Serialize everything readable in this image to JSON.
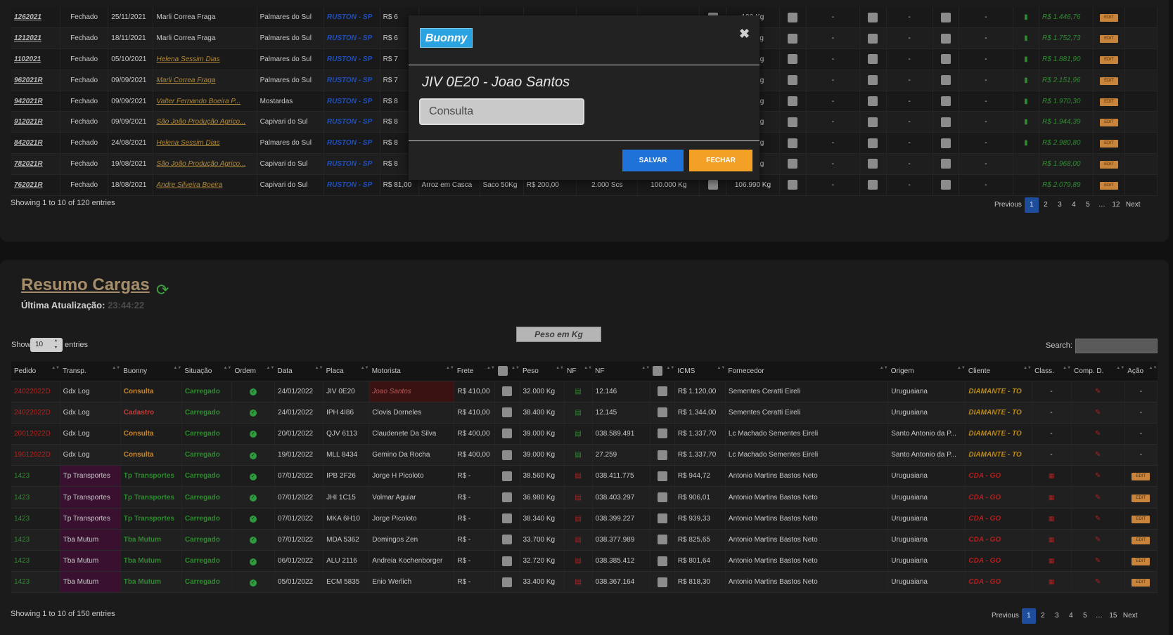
{
  "top_table": {
    "rows": [
      {
        "pedido": "1262021",
        "status": "Fechado",
        "data": "25/11/2021",
        "cliente": "Marli Correa Fraga",
        "cliente_link": false,
        "cidade": "Palmares do Sul",
        "transp": "RUSTON - SP",
        "valor": "R$ 6",
        "tipo": "",
        "emb": "",
        "total": "",
        "qtd": "",
        "peso": "",
        "peso_real": "190 Kg",
        "doc": true,
        "total_final": "R$ 1.446,76",
        "acao": "EDIT"
      },
      {
        "pedido": "1212021",
        "status": "Fechado",
        "data": "18/11/2021",
        "cliente": "Marli Correa Fraga",
        "cliente_link": false,
        "cidade": "Palmares do Sul",
        "transp": "RUSTON - SP",
        "valor": "R$ 6",
        "tipo": "",
        "emb": "",
        "total": "",
        "qtd": "",
        "peso": "",
        "peso_real": "110 Kg",
        "doc": true,
        "total_final": "R$ 1.752,73",
        "acao": "EDIT"
      },
      {
        "pedido": "1102021",
        "status": "Fechado",
        "data": "05/10/2021",
        "cliente": "Helena Sessim Dias",
        "cliente_link": true,
        "cidade": "Palmares do Sul",
        "transp": "RUSTON - SP",
        "valor": "R$ 7",
        "tipo": "",
        "emb": "",
        "total": "",
        "qtd": "",
        "peso": "",
        "peso_real": "550 Kg",
        "doc": true,
        "total_final": "R$ 1.881,90",
        "acao": "EDIT"
      },
      {
        "pedido": "962021R",
        "status": "Fechado",
        "data": "09/09/2021",
        "cliente": "Marli Correa Fraga",
        "cliente_link": true,
        "cidade": "Palmares do Sul",
        "transp": "RUSTON - SP",
        "valor": "R$ 7",
        "tipo": "",
        "emb": "",
        "total": "",
        "qtd": "",
        "peso": "",
        "peso_real": "500 Kg",
        "doc": true,
        "total_final": "R$ 2.151,96",
        "acao": "EDIT"
      },
      {
        "pedido": "942021R",
        "status": "Fechado",
        "data": "09/09/2021",
        "cliente": "Valter Fernando Boeira P...",
        "cliente_link": true,
        "cidade": "Mostardas",
        "transp": "RUSTON - SP",
        "valor": "R$ 8",
        "tipo": "",
        "emb": "",
        "total": "",
        "qtd": "",
        "peso": "",
        "peso_real": "620 Kg",
        "doc": true,
        "total_final": "R$ 1.970,30",
        "acao": "EDIT"
      },
      {
        "pedido": "912021R",
        "status": "Fechado",
        "data": "09/09/2021",
        "cliente": "São João Produção Agrico...",
        "cliente_link": true,
        "cidade": "Capivari do Sul",
        "transp": "RUSTON - SP",
        "valor": "R$ 8",
        "tipo": "",
        "emb": "",
        "total": "",
        "qtd": "",
        "peso": "",
        "peso_real": "020 Kg",
        "doc": true,
        "total_final": "R$ 1.944,39",
        "acao": "EDIT"
      },
      {
        "pedido": "842021R",
        "status": "Fechado",
        "data": "24/08/2021",
        "cliente": "Helena Sessim Dias",
        "cliente_link": true,
        "cidade": "Palmares do Sul",
        "transp": "RUSTON - SP",
        "valor": "R$ 8",
        "tipo": "",
        "emb": "",
        "total": "",
        "qtd": "",
        "peso": "",
        "peso_real": "250 Kg",
        "doc": true,
        "total_final": "R$ 2.980,80",
        "acao": "EDIT"
      },
      {
        "pedido": "782021R",
        "status": "Fechado",
        "data": "19/08/2021",
        "cliente": "São João Produção Agrico...",
        "cliente_link": true,
        "cidade": "Capivari do Sul",
        "transp": "RUSTON - SP",
        "valor": "R$ 8",
        "tipo": "",
        "emb": "",
        "total": "",
        "qtd": "",
        "peso": "",
        "peso_real": "000 Kg",
        "doc": false,
        "total_final": "R$ 1.968,00",
        "acao": "EDIT"
      },
      {
        "pedido": "762021R",
        "status": "Fechado",
        "data": "18/08/2021",
        "cliente": "Andre Silveira Boeira",
        "cliente_link": true,
        "cidade": "Capivari do Sul",
        "transp": "RUSTON - SP",
        "valor": "R$ 81,00",
        "tipo": "Arroz em Casca",
        "emb": "Saco 50Kg",
        "total": "R$ 200,00",
        "qtd": "2.000 Scs",
        "peso": "100.000 Kg",
        "peso_real": "106.990 Kg",
        "doc": false,
        "total_final": "R$ 2.079,89",
        "acao": "EDIT"
      }
    ],
    "dash": "-",
    "info": "Showing 1 to 10 of 120 entries",
    "pager": {
      "previous": "Previous",
      "pages": [
        "1",
        "2",
        "3",
        "4",
        "5",
        "…",
        "12"
      ],
      "next": "Next"
    }
  },
  "modal": {
    "logo": "Buonny",
    "close_icon": "close-icon",
    "title": "JIV 0E20 - Joao Santos",
    "input_value": "Consulta",
    "save_label": "SALVAR",
    "close_label": "FECHAR",
    "colors": {
      "save": "#1f72d8",
      "close": "#f3a126",
      "logo": "#2aa3e0"
    }
  },
  "resumo": {
    "title": "Resumo Cargas",
    "refresh_icon": "refresh-icon",
    "updated_label": "Última Atualização:",
    "updated_time": "23:44:22",
    "unit_label": "Peso em Kg",
    "show_label": "Show",
    "show_value": "10",
    "entries_label": "entries",
    "search_label": "Search:",
    "search_value": "",
    "columns": [
      "Pedido",
      "Transp.",
      "Buonny",
      "Situação",
      "Ordem",
      "Data",
      "Placa",
      "Motorista",
      "Frete",
      "",
      "Peso",
      "NF",
      "NF",
      "",
      "ICMS",
      "Fornecedor",
      "Origem",
      "Cliente",
      "Class.",
      "Comp. D.",
      "Ação"
    ],
    "rows": [
      {
        "pedido": "24022022D",
        "transp": "Gdx Log",
        "buonny": "Consulta",
        "situacao": "Carregado",
        "data": "24/01/2022",
        "placa": "JIV 0E20",
        "motorista": "Joao Santos",
        "frete": "R$ 410,00",
        "peso": "32.000 Kg",
        "nf": "12.146",
        "icms": "R$ 1.120,00",
        "fornecedor": "Sementes Ceratti Eireli",
        "origem": "Uruguaiana",
        "cliente": "DIAMANTE - TO",
        "classe": "-",
        "acao": "-"
      },
      {
        "pedido": "24022022D",
        "transp": "Gdx Log",
        "buonny": "Cadastro",
        "situacao": "Carregado",
        "data": "24/01/2022",
        "placa": "IPH 4I86",
        "motorista": "Clovis Dorneles",
        "frete": "R$ 410,00",
        "peso": "38.400 Kg",
        "nf": "12.145",
        "icms": "R$ 1.344,00",
        "fornecedor": "Sementes Ceratti Eireli",
        "origem": "Uruguaiana",
        "cliente": "DIAMANTE - TO",
        "classe": "-",
        "acao": "-"
      },
      {
        "pedido": "20012022D",
        "transp": "Gdx Log",
        "buonny": "Consulta",
        "situacao": "Carregado",
        "data": "20/01/2022",
        "placa": "QJV 6113",
        "motorista": "Claudenete Da Silva",
        "frete": "R$ 400,00",
        "peso": "39.000 Kg",
        "nf": "038.589.491",
        "icms": "R$ 1.337,70",
        "fornecedor": "Lc Machado Sementes Eireli",
        "origem": "Santo Antonio da P...",
        "cliente": "DIAMANTE - TO",
        "classe": "-",
        "acao": "-"
      },
      {
        "pedido": "19012022D",
        "transp": "Gdx Log",
        "buonny": "Consulta",
        "situacao": "Carregado",
        "data": "19/01/2022",
        "placa": "MLL 8434",
        "motorista": "Gemino Da Rocha",
        "frete": "R$ 400,00",
        "peso": "39.000 Kg",
        "nf": "27.259",
        "icms": "R$ 1.337,70",
        "fornecedor": "Lc Machado Sementes Eireli",
        "origem": "Santo Antonio da P...",
        "cliente": "DIAMANTE - TO",
        "classe": "-",
        "acao": "-"
      },
      {
        "pedido": "1423",
        "transp": "Tp Transportes",
        "buonny": "Tp Transportes",
        "situacao": "Carregado",
        "data": "07/01/2022",
        "placa": "IPB 2F26",
        "motorista": "Jorge H Picoloto",
        "frete": "R$   -",
        "peso": "38.560 Kg",
        "nf": "038.411.775",
        "icms": "R$ 944,72",
        "fornecedor": "Antonio Martins Bastos Neto",
        "origem": "Uruguaiana",
        "cliente": "CDA - GO",
        "classe": "",
        "acao": "EDIT"
      },
      {
        "pedido": "1423",
        "transp": "Tp Transportes",
        "buonny": "Tp Transportes",
        "situacao": "Carregado",
        "data": "07/01/2022",
        "placa": "JHI 1C15",
        "motorista": "Volmar Aguiar",
        "frete": "R$   -",
        "peso": "36.980 Kg",
        "nf": "038.403.297",
        "icms": "R$ 906,01",
        "fornecedor": "Antonio Martins Bastos Neto",
        "origem": "Uruguaiana",
        "cliente": "CDA - GO",
        "classe": "",
        "acao": "EDIT"
      },
      {
        "pedido": "1423",
        "transp": "Tp Transportes",
        "buonny": "Tp Transportes",
        "situacao": "Carregado",
        "data": "07/01/2022",
        "placa": "MKA 6H10",
        "motorista": "Jorge Picoloto",
        "frete": "R$   -",
        "peso": "38.340 Kg",
        "nf": "038.399.227",
        "icms": "R$ 939,33",
        "fornecedor": "Antonio Martins Bastos Neto",
        "origem": "Uruguaiana",
        "cliente": "CDA - GO",
        "classe": "",
        "acao": "EDIT"
      },
      {
        "pedido": "1423",
        "transp": "Tba Mutum",
        "buonny": "Tba Mutum",
        "situacao": "Carregado",
        "data": "07/01/2022",
        "placa": "MDA 5362",
        "motorista": "Domingos Zen",
        "frete": "R$   -",
        "peso": "33.700 Kg",
        "nf": "038.377.989",
        "icms": "R$ 825,65",
        "fornecedor": "Antonio Martins Bastos Neto",
        "origem": "Uruguaiana",
        "cliente": "CDA - GO",
        "classe": "",
        "acao": "EDIT"
      },
      {
        "pedido": "1423",
        "transp": "Tba Mutum",
        "buonny": "Tba Mutum",
        "situacao": "Carregado",
        "data": "06/01/2022",
        "placa": "ALU 2116",
        "motorista": "Andreia Kochenborger",
        "frete": "R$   -",
        "peso": "32.720 Kg",
        "nf": "038.385.412",
        "icms": "R$ 801,64",
        "fornecedor": "Antonio Martins Bastos Neto",
        "origem": "Uruguaiana",
        "cliente": "CDA - GO",
        "classe": "",
        "acao": "EDIT"
      },
      {
        "pedido": "1423",
        "transp": "Tba Mutum",
        "buonny": "Tba Mutum",
        "situacao": "Carregado",
        "data": "05/01/2022",
        "placa": "ECM 5835",
        "motorista": "Enio Werlich",
        "frete": "R$   -",
        "peso": "33.400 Kg",
        "nf": "038.367.164",
        "icms": "R$ 818,30",
        "fornecedor": "Antonio Martins Bastos Neto",
        "origem": "Uruguaiana",
        "cliente": "CDA - GO",
        "classe": "",
        "acao": "EDIT"
      }
    ],
    "info": "Showing 1 to 10 of 150 entries",
    "pager": {
      "previous": "Previous",
      "pages": [
        "1",
        "2",
        "3",
        "4",
        "5",
        "…",
        "15"
      ],
      "next": "Next"
    }
  }
}
